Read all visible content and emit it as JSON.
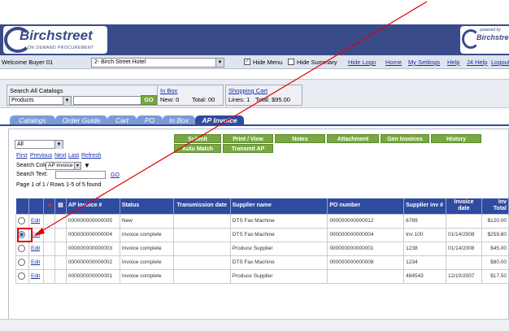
{
  "header": {
    "logo_text": "Birchstreet",
    "logo_sub": "ON DEMAND PROCUREMENT",
    "powered_by": "powered by",
    "powered_logo": "Birchstree"
  },
  "nav": {
    "welcome": "Welcome Buyer 01",
    "hotel": "2- Birch Street Hotel",
    "hide_menu": "Hide Menu",
    "hide_summary": "Hide Summary",
    "links": [
      "Hide Logo",
      "Home",
      "My Settings",
      "Help",
      "J4 Help",
      "Logout"
    ]
  },
  "search": {
    "label": "Search All Catalogs",
    "catalog_value": "Products",
    "go": "GO"
  },
  "inbox": {
    "title": "In Box",
    "new_label": "New: 0",
    "total_label": "Total: 00"
  },
  "cart": {
    "title": "Shopping Cart",
    "lines": "Lines: 1",
    "total": "Total: $95.00"
  },
  "tabs": [
    "Catalogs",
    "Order Guide",
    "Cart",
    "PO",
    "In Box",
    "AP Invoice"
  ],
  "toolbar": {
    "filter": "All",
    "pager": [
      "First",
      "Previous",
      "Next",
      "Last",
      "Refresh"
    ],
    "search_column_label": "Search Column:",
    "search_column_value": "AP invoice #",
    "search_text_label": "Search Text:",
    "go": "GO",
    "page_info": "Page 1 of 1 / Rows 1-5 of 5 found",
    "buttons_row1": [
      "Submit",
      "Print / View",
      "Notes",
      "Attachment",
      "Gen Invoices",
      "History"
    ],
    "buttons_row2": [
      "Auto Match",
      "Transmit AP"
    ]
  },
  "table": {
    "headers": [
      "",
      "",
      "",
      "",
      "AP invoice #",
      "Status",
      "Transmission date",
      "Supplier name",
      "PO number",
      "Supplier inv #",
      "Invoice date",
      "Inv Total"
    ],
    "edit_label": "Edit",
    "rows": [
      {
        "invoice": "000000000000005",
        "status": "New",
        "supplier": "DTS Fax Machine",
        "po": "000000000000012",
        "supp_inv": "6789",
        "date": "",
        "total": "$120.00"
      },
      {
        "invoice": "000000000000004",
        "status": "Invoice complete",
        "supplier": "DTS Fax Machine",
        "po": "000000000000004",
        "supp_inv": "Inv 100",
        "date": "01/14/2008",
        "total": "$259.80"
      },
      {
        "invoice": "000000000000003",
        "status": "Invoice complete",
        "supplier": "Produce Supplier",
        "po": "000000000000001",
        "supp_inv": "1238",
        "date": "01/14/2008",
        "total": "$45.00"
      },
      {
        "invoice": "000000000000002",
        "status": "Invoice complete",
        "supplier": "DTS Fax Machine",
        "po": "000000000000008",
        "supp_inv": "1234",
        "date": "",
        "total": "$80.00"
      },
      {
        "invoice": "000000000000001",
        "status": "Invoice complete",
        "supplier": "Produce Supplier",
        "po": "",
        "supp_inv": "484543",
        "date": "12/10/2007",
        "total": "$17.50"
      }
    ]
  },
  "colors": {
    "brand": "#3a4b8a",
    "tab_active": "#2f4ba0",
    "tab": "#7b9bd8",
    "button": "#78a841",
    "annotation": "#e00000"
  }
}
